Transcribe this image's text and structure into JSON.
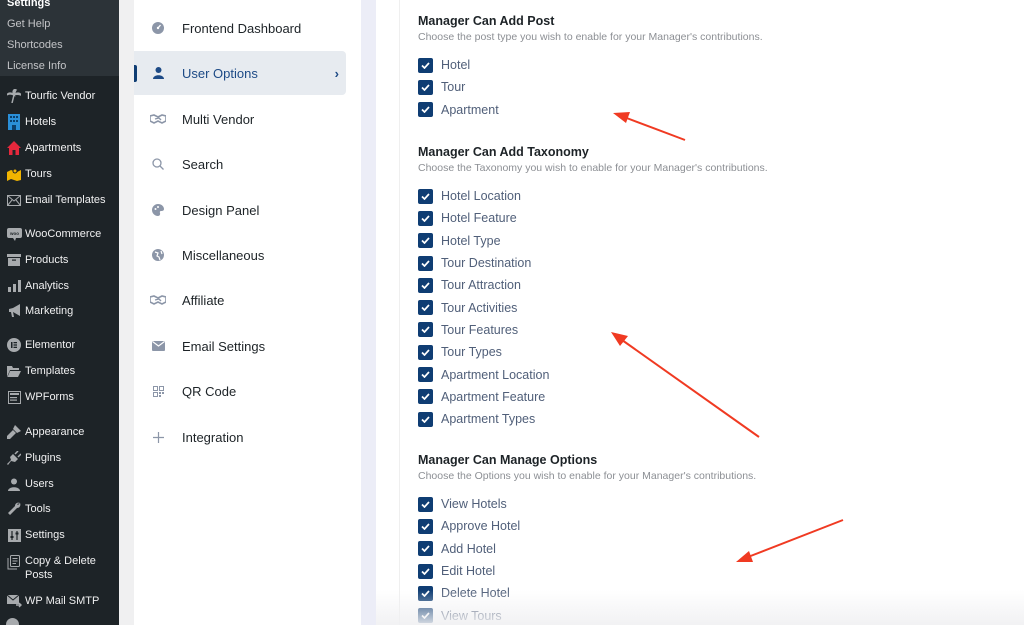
{
  "wp_sidebar": {
    "submenu": [
      {
        "label": "Settings",
        "current": true
      },
      {
        "label": "Get Help"
      },
      {
        "label": "Shortcodes"
      },
      {
        "label": "License Info"
      }
    ],
    "items": [
      {
        "label": "Tourfic Vendor",
        "icon": "palm-tree-icon"
      },
      {
        "label": "Hotels",
        "icon": "hotel-building-icon"
      },
      {
        "label": "Apartments",
        "icon": "house-icon"
      },
      {
        "label": "Tours",
        "icon": "map-pin-icon"
      },
      {
        "label": "Email Templates",
        "icon": "envelope-icon"
      },
      {
        "label": "WooCommerce",
        "icon": "woocommerce-icon"
      },
      {
        "label": "Products",
        "icon": "archive-box-icon"
      },
      {
        "label": "Analytics",
        "icon": "bar-chart-icon"
      },
      {
        "label": "Marketing",
        "icon": "megaphone-icon"
      },
      {
        "label": "Elementor",
        "icon": "elementor-icon"
      },
      {
        "label": "Templates",
        "icon": "folder-open-icon"
      },
      {
        "label": "WPForms",
        "icon": "form-icon"
      },
      {
        "label": "Appearance",
        "icon": "paintbrush-icon"
      },
      {
        "label": "Plugins",
        "icon": "plug-icon"
      },
      {
        "label": "Users",
        "icon": "user-icon"
      },
      {
        "label": "Tools",
        "icon": "wrench-icon"
      },
      {
        "label": "Settings",
        "icon": "sliders-icon"
      },
      {
        "label": "Copy & Delete Posts",
        "line1": "Copy & Delete",
        "line2": "Posts",
        "icon": "copy-document-icon"
      },
      {
        "label": "WP Mail SMTP",
        "icon": "mail-send-icon"
      }
    ]
  },
  "settings_nav": {
    "items": [
      {
        "label": "Frontend Dashboard",
        "icon": "dashboard-gauge-icon"
      },
      {
        "label": "User Options",
        "icon": "user-icon",
        "active": true
      },
      {
        "label": "Multi Vendor",
        "icon": "handshake-icon"
      },
      {
        "label": "Search",
        "icon": "search-icon"
      },
      {
        "label": "Design Panel",
        "icon": "palette-icon"
      },
      {
        "label": "Miscellaneous",
        "icon": "globe-icon"
      },
      {
        "label": "Affiliate",
        "icon": "handshake-icon"
      },
      {
        "label": "Email Settings",
        "icon": "envelope-icon"
      },
      {
        "label": "QR Code",
        "icon": "qr-code-icon"
      },
      {
        "label": "Integration",
        "icon": "plus-icon"
      }
    ],
    "active_chevron": "›"
  },
  "sections": [
    {
      "title": "Manager Can Add Post",
      "description": "Choose the post type you wish to enable for your Manager's contributions.",
      "options": [
        {
          "label": "Hotel",
          "checked": true
        },
        {
          "label": "Tour",
          "checked": true
        },
        {
          "label": "Apartment",
          "checked": true
        }
      ]
    },
    {
      "title": "Manager Can Add Taxonomy",
      "description": "Choose the Taxonomy you wish to enable for your Manager's contributions.",
      "options": [
        {
          "label": "Hotel Location",
          "checked": true
        },
        {
          "label": "Hotel Feature",
          "checked": true
        },
        {
          "label": "Hotel Type",
          "checked": true
        },
        {
          "label": "Tour Destination",
          "checked": true
        },
        {
          "label": "Tour Attraction",
          "checked": true
        },
        {
          "label": "Tour Activities",
          "checked": true
        },
        {
          "label": "Tour Features",
          "checked": true
        },
        {
          "label": "Tour Types",
          "checked": true
        },
        {
          "label": "Apartment Location",
          "checked": true
        },
        {
          "label": "Apartment Feature",
          "checked": true
        },
        {
          "label": "Apartment Types",
          "checked": true
        }
      ]
    },
    {
      "title": "Manager Can Manage Options",
      "description": "Choose the Options you wish to enable for your Manager's contributions.",
      "options": [
        {
          "label": "View Hotels",
          "checked": true
        },
        {
          "label": "Approve Hotel",
          "checked": true
        },
        {
          "label": "Add Hotel",
          "checked": true
        },
        {
          "label": "Edit Hotel",
          "checked": true
        },
        {
          "label": "Delete Hotel",
          "checked": true
        },
        {
          "label": "View Tours",
          "checked": true
        }
      ]
    }
  ],
  "colors": {
    "wp_sidebar_bg": "#1d2327",
    "accent": "#0f3d73",
    "annotation_arrow": "#f03a22"
  }
}
